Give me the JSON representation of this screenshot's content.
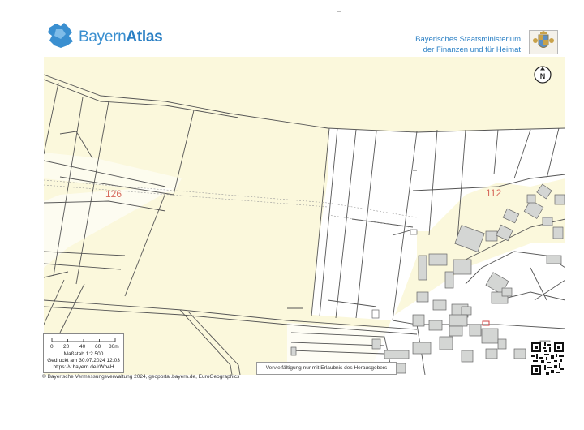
{
  "header": {
    "logo_text_light": "Bayern",
    "logo_text_bold": "Atlas",
    "ministry_line1": "Bayerisches Staatsministerium",
    "ministry_line2": "der Finanzen und für Heimat"
  },
  "map": {
    "north_label": "N",
    "parcel_labels": [
      "126",
      "112"
    ],
    "colors": {
      "fields": "#fbf8dc",
      "built_area": "#ffffff",
      "buildings": "#d4d6d4",
      "parcel_lines": "#555555",
      "parcel_numbers": "#d76a5c",
      "brand": "#2a7fc4"
    }
  },
  "scale": {
    "ticks": [
      "0",
      "20",
      "40",
      "60",
      "80m"
    ],
    "scale_text": "Maßstab 1:2.500",
    "printed": "Gedruckt am 30.07.2024 12:03",
    "url": "https://v.bayern.de/rWb4H"
  },
  "notice": "Vervielfältigung nur mit Erlaubnis des Herausgebers",
  "copyright": "© Bayerische Vermessungsverwaltung 2024, geoportal.bayern.de, EuroGeographics"
}
